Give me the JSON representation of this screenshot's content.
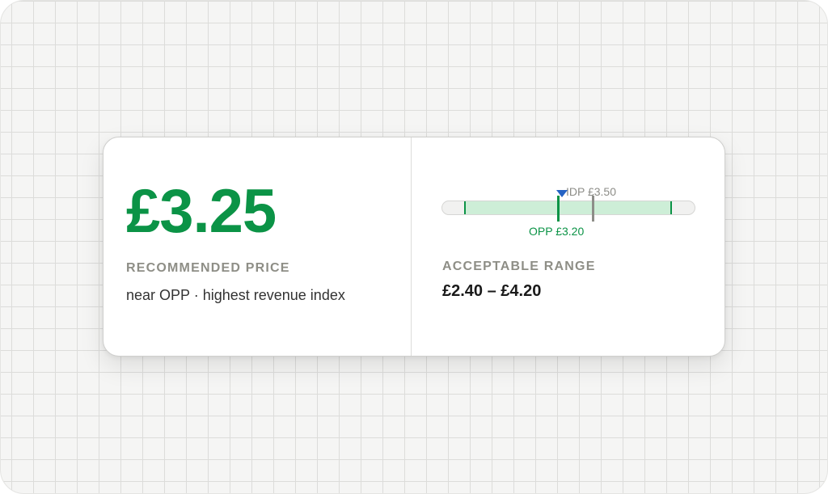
{
  "recommendation": {
    "price": "£3.25",
    "label": "RECOMMENDED PRICE",
    "note": "near OPP · highest revenue index"
  },
  "range": {
    "label": "ACCEPTABLE RANGE",
    "value": "£2.40 – £4.20",
    "min": 2.4,
    "max": 4.2,
    "opp": 3.2,
    "idp": 3.5,
    "recommended": 3.25,
    "opp_label": "OPP £3.20",
    "idp_label": "IDP £3.50"
  },
  "colors": {
    "accent": "#0b9346",
    "band": "#cdeed7",
    "marker": "#2563c4",
    "idp": "#8d8d88"
  }
}
